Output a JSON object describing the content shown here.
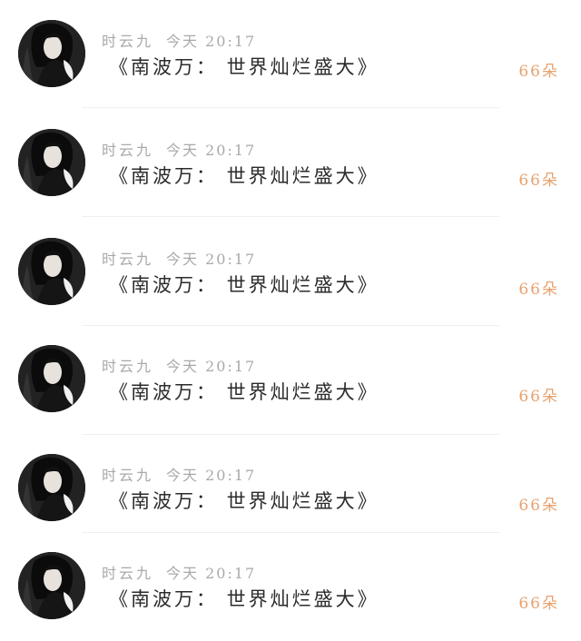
{
  "colors": {
    "name_and_time": "#a9a9a9",
    "message": "#2b2b2b",
    "count": "#e8a26f",
    "divider": "#f0f0f0"
  },
  "items": [
    {
      "username": "时云九",
      "time": "今天 20:17",
      "message": "《南波万： 世界灿烂盛大》",
      "count": "66朵",
      "avatar_icon": "user-avatar-icon"
    },
    {
      "username": "时云九",
      "time": "今天 20:17",
      "message": "《南波万： 世界灿烂盛大》",
      "count": "66朵",
      "avatar_icon": "user-avatar-icon"
    },
    {
      "username": "时云九",
      "time": "今天 20:17",
      "message": "《南波万： 世界灿烂盛大》",
      "count": "66朵",
      "avatar_icon": "user-avatar-icon"
    },
    {
      "username": "时云九",
      "time": "今天 20:17",
      "message": "《南波万： 世界灿烂盛大》",
      "count": "66朵",
      "avatar_icon": "user-avatar-icon"
    },
    {
      "username": "时云九",
      "time": "今天 20:17",
      "message": "《南波万： 世界灿烂盛大》",
      "count": "66朵",
      "avatar_icon": "user-avatar-icon"
    },
    {
      "username": "时云九",
      "time": "今天 20:17",
      "message": "《南波万： 世界灿烂盛大》",
      "count": "66朵",
      "avatar_icon": "user-avatar-icon"
    }
  ]
}
